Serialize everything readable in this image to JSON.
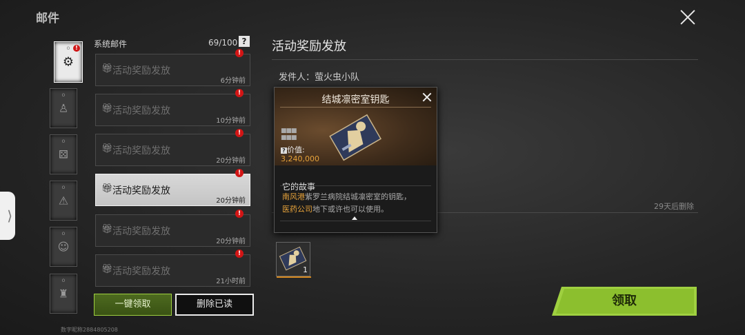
{
  "header": {
    "title": "邮件"
  },
  "side_tab": {
    "label": "⟩"
  },
  "categories": [
    {
      "icon": "⚙",
      "badge": "!",
      "active": true
    },
    {
      "icon": "♙"
    },
    {
      "icon": "⚄"
    },
    {
      "icon": "⚠"
    },
    {
      "icon": "☺"
    },
    {
      "icon": "♜"
    }
  ],
  "list": {
    "section": "系统邮件",
    "count": "69/100",
    "help": "?",
    "items": [
      {
        "title": "活动奖励发放",
        "time": "6分钟前",
        "badge": "!"
      },
      {
        "title": "活动奖励发放",
        "time": "10分钟前",
        "badge": "!"
      },
      {
        "title": "活动奖励发放",
        "time": "20分钟前",
        "badge": "!"
      },
      {
        "title": "活动奖励发放",
        "time": "20分钟前",
        "badge": "!",
        "selected": true
      },
      {
        "title": "活动奖励发放",
        "time": "20分钟前",
        "badge": "!"
      },
      {
        "title": "活动奖励发放",
        "time": "21小时前",
        "badge": "!"
      }
    ],
    "claim_all": "一键领取",
    "delete_read": "删除已读"
  },
  "user_id": "数字昵称2884805208",
  "detail": {
    "title": "活动奖励发放",
    "sender": "发件人：萤火虫小队",
    "expire": "29天后删除",
    "attachment_count": "1",
    "claim_label": "领取"
  },
  "popup": {
    "title": "结城凛密室钥匙",
    "value_label": "价值:",
    "value": "3,240,000",
    "story_heading": "它的故事",
    "story_line1_hl": "南风港",
    "story_line1": "紫罗兰病院结城凛密室的钥匙，",
    "story_line2_hl": "医药公司",
    "story_line2": "地下或许也可以使用。"
  },
  "colors": {
    "accent_green": "#9fd040",
    "value_orange": "#e6a23a",
    "badge_red": "#d21515"
  }
}
